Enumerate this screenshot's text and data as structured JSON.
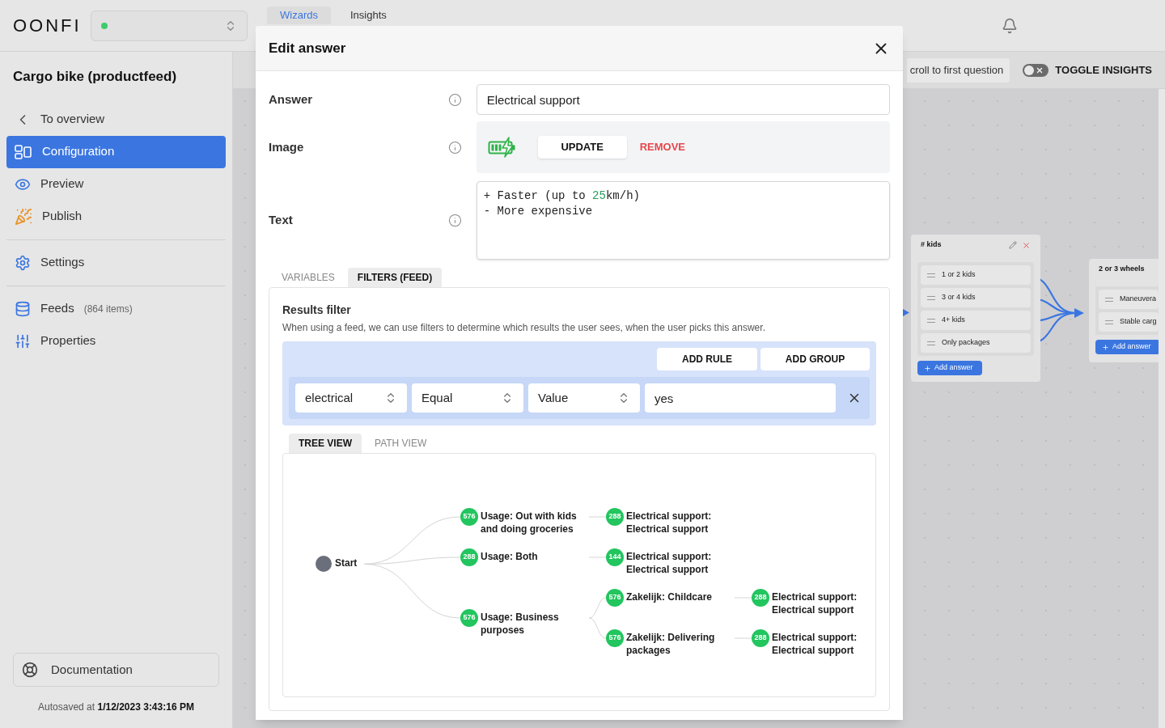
{
  "header": {
    "logo": "OONFI",
    "project_select": {
      "online": true
    },
    "tabs": [
      {
        "label": "Wizards",
        "selected": true
      },
      {
        "label": "Insights",
        "selected": false
      }
    ]
  },
  "sidebar": {
    "title": "Cargo bike (productfeed)",
    "groups": [
      [
        {
          "label": "To overview",
          "selected": false
        },
        {
          "label": "Configuration",
          "selected": true
        },
        {
          "label": "Preview",
          "selected": false
        },
        {
          "label": "Publish",
          "selected": false
        }
      ],
      [
        {
          "label": "Settings",
          "selected": false
        }
      ],
      [
        {
          "label": "Feeds",
          "count": "(864 items)",
          "selected": false
        },
        {
          "label": "Properties",
          "selected": false
        }
      ]
    ],
    "documentation": "Documentation",
    "autosave": {
      "label": "Autosaved at",
      "time": "1/12/2023 3:43:16 PM"
    }
  },
  "toolbar": {
    "scroll_button": "croll to first question",
    "insights_toggle": {
      "label": "TOGGLE INSIGHTS",
      "on": false
    }
  },
  "canvas": {
    "cards": [
      {
        "title": "# kids",
        "answers": [
          "1 or 2 kids",
          "3 or 4 kids",
          "4+ kids",
          "Only packages"
        ],
        "add_button": "Add answer"
      },
      {
        "title": "2 or 3 wheels",
        "answers": [
          "Maneuvera",
          "Stable carg"
        ],
        "add_button": "Add answer"
      }
    ]
  },
  "modal": {
    "title": "Edit answer",
    "answer": {
      "label": "Answer",
      "value": "Electrical support"
    },
    "image": {
      "label": "Image",
      "update": "UPDATE",
      "remove": "REMOVE"
    },
    "text": {
      "label": "Text",
      "lines": [
        [
          {
            "text": "+ Faster (up to "
          },
          {
            "text": "25",
            "kind": "number"
          },
          {
            "text": "km/h)"
          }
        ],
        [
          {
            "text": "- More expensive"
          }
        ]
      ]
    },
    "tabs": [
      {
        "label": "VARIABLES",
        "selected": false
      },
      {
        "label": "FILTERS (FEED)",
        "selected": true
      }
    ],
    "results_filter": {
      "title": "Results filter",
      "description": "When using a feed, we can use filters to determine which results the user sees, when the user picks this answer.",
      "add_rule": "ADD RULE",
      "add_group": "ADD GROUP",
      "rule": {
        "field": "electrical",
        "operator": "Equal",
        "value_type": "Value",
        "value": "yes"
      }
    },
    "view_tabs": [
      {
        "label": "TREE VIEW",
        "selected": true
      },
      {
        "label": "PATH VIEW",
        "selected": false
      }
    ],
    "tree": {
      "label": "Start",
      "children": [
        {
          "count": "576",
          "label": "Usage: Out with kids\nand doing groceries",
          "children": [
            {
              "count": "288",
              "label": "Electrical support:\nElectrical support"
            }
          ]
        },
        {
          "count": "288",
          "label": "Usage: Both",
          "children": [
            {
              "count": "144",
              "label": "Electrical support:\nElectrical support"
            }
          ]
        },
        {
          "count": "576",
          "label": "Usage: Business\npurposes",
          "children": [
            {
              "count": "576",
              "label": "Zakelijk: Childcare",
              "children": [
                {
                  "count": "288",
                  "label": "Electrical support:\nElectrical support"
                }
              ]
            },
            {
              "count": "576",
              "label": "Zakelijk: Delivering\npackages",
              "children": [
                {
                  "count": "288",
                  "label": "Electrical support:\nElectrical support"
                }
              ]
            }
          ]
        }
      ]
    }
  }
}
